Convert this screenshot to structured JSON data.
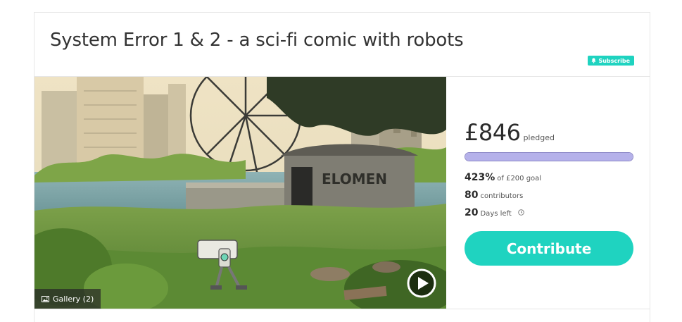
{
  "campaign": {
    "title": "System Error 1 & 2 - a sci-fi comic with robots",
    "subscribe_label": "Subscribe"
  },
  "media": {
    "gallery_label": "Gallery (2)",
    "art_text": "ELOMEN"
  },
  "funding": {
    "amount": "£846",
    "pledged_label": "pledged",
    "progress_fraction": 1.0,
    "percent": "423%",
    "goal_label": "of £200 goal",
    "contributors_count": "80",
    "contributors_label": "contributors",
    "days_count": "20",
    "days_label": "Days left",
    "contribute_label": "Contribute"
  },
  "colors": {
    "accent": "#1fd3c0",
    "progress_fill": "#b5b1ea",
    "progress_border": "#8b86c6"
  }
}
